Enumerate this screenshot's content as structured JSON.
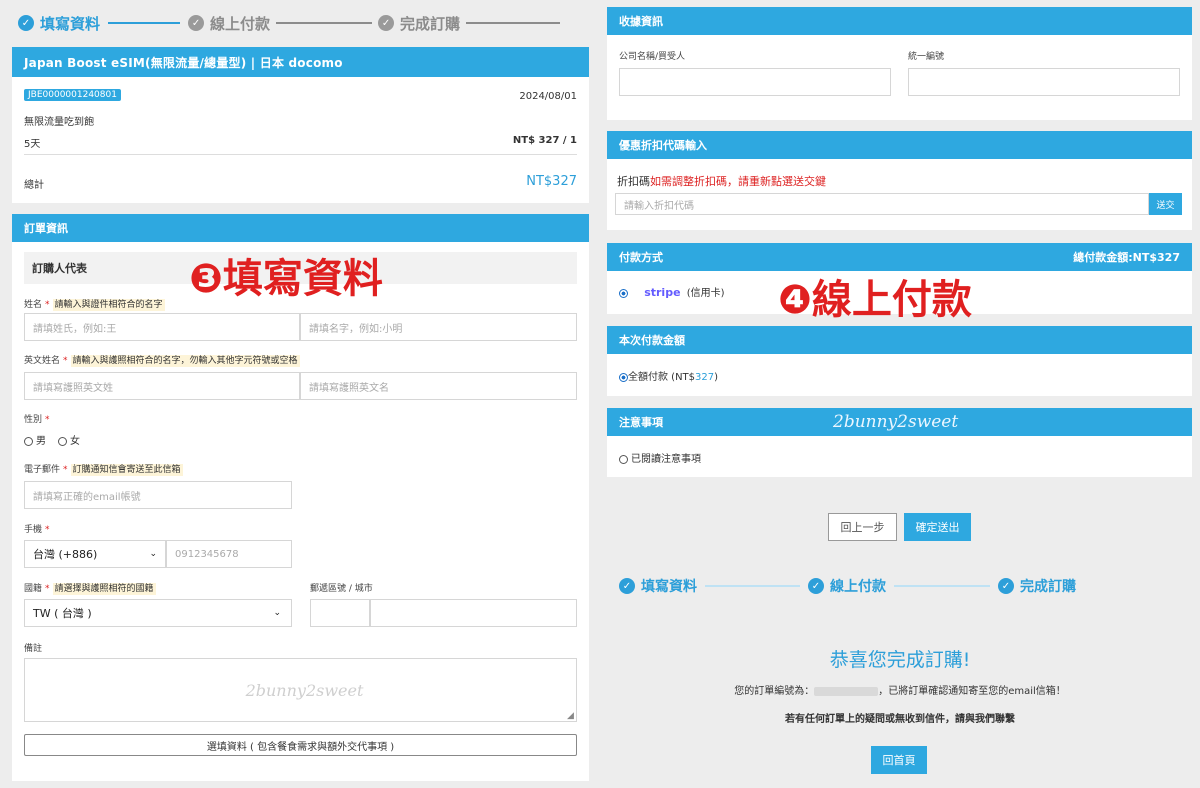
{
  "steps_top": {
    "step1": "填寫資料",
    "step2": "線上付款",
    "step3": "完成訂購"
  },
  "product": {
    "title": "Japan Boost eSIM(無限流量/總量型) | 日本 docomo",
    "code": "JBE0000001240801",
    "date": "2024/08/01",
    "plan": "無限流量吃到飽",
    "days": "5天",
    "price": "NT$ 327 / 1",
    "total_label": "總計",
    "total_value": "NT$327"
  },
  "order": {
    "header": "訂單資訊",
    "section_title": "訂購人代表",
    "name_label": "姓名",
    "name_note": "請輸入與證件相符合的名字",
    "lastname_placeholder": "請填姓氏，例如:王",
    "firstname_placeholder": "請填名字，例如:小明",
    "en_label": "英文姓名",
    "en_note": "請輸入與護照相符合的名字，勿輸入其他字元符號或空格",
    "en_last_placeholder": "請填寫護照英文姓",
    "en_first_placeholder": "請填寫護照英文名",
    "gender_label": "性別",
    "male": "男",
    "female": "女",
    "email_label": "電子郵件",
    "email_note": "訂購通知信會寄送至此信箱",
    "email_placeholder": "請填寫正確的email帳號",
    "phone_label": "手機",
    "phone_country": "台灣 (+886)",
    "phone_placeholder": "0912345678",
    "country_label": "國籍",
    "country_note": "請選擇與護照相符的國籍",
    "country_value": "TW ( 台灣 )",
    "zip_label": "郵遞區號 / 城市",
    "remark_label": "備註",
    "extra_button": "選填資料 ( 包含餐食需求與額外交代事項 )"
  },
  "annotations": {
    "step3": "❸填寫資料",
    "step4": "❹線上付款",
    "watermark": "2bunny2sweet"
  },
  "receipt": {
    "header": "收據資訊",
    "company_label": "公司名稱/買受人",
    "tax_label": "統一編號"
  },
  "coupon": {
    "header": "優惠折扣代碼輸入",
    "prefix": "折扣碼",
    "warning": "如需調整折扣碼，請重新點選送交鍵",
    "placeholder": "請輸入折扣代碼",
    "submit": "送交"
  },
  "payment": {
    "header": "付款方式",
    "total": "總付款金額:NT$327",
    "stripe": "stripe",
    "card": "(信用卡)"
  },
  "amount": {
    "header": "本次付款金額",
    "full_label": "全額付款 (NT$",
    "full_value": "327",
    "full_close": ")"
  },
  "notice": {
    "header": "注意事項",
    "read": "已閱讀注意事項"
  },
  "actions": {
    "back": "回上一步",
    "confirm": "確定送出"
  },
  "steps_bottom": {
    "step1": "填寫資料",
    "step2": "線上付款",
    "step3": "完成訂購"
  },
  "complete": {
    "title": "恭喜您完成訂購!",
    "order_prefix": "您的訂單編號為：",
    "order_suffix": "，已將訂單確認通知寄至您的email信箱！",
    "contact": "若有任何訂單上的疑問或無收到信件，請與我們聯繫",
    "home": "回首頁"
  },
  "colors": {
    "accent": "#2ea8e0",
    "done": "#2d9fd9",
    "pending": "#9a9a9a",
    "required": "#dd2222",
    "annotation": "#e02020"
  }
}
